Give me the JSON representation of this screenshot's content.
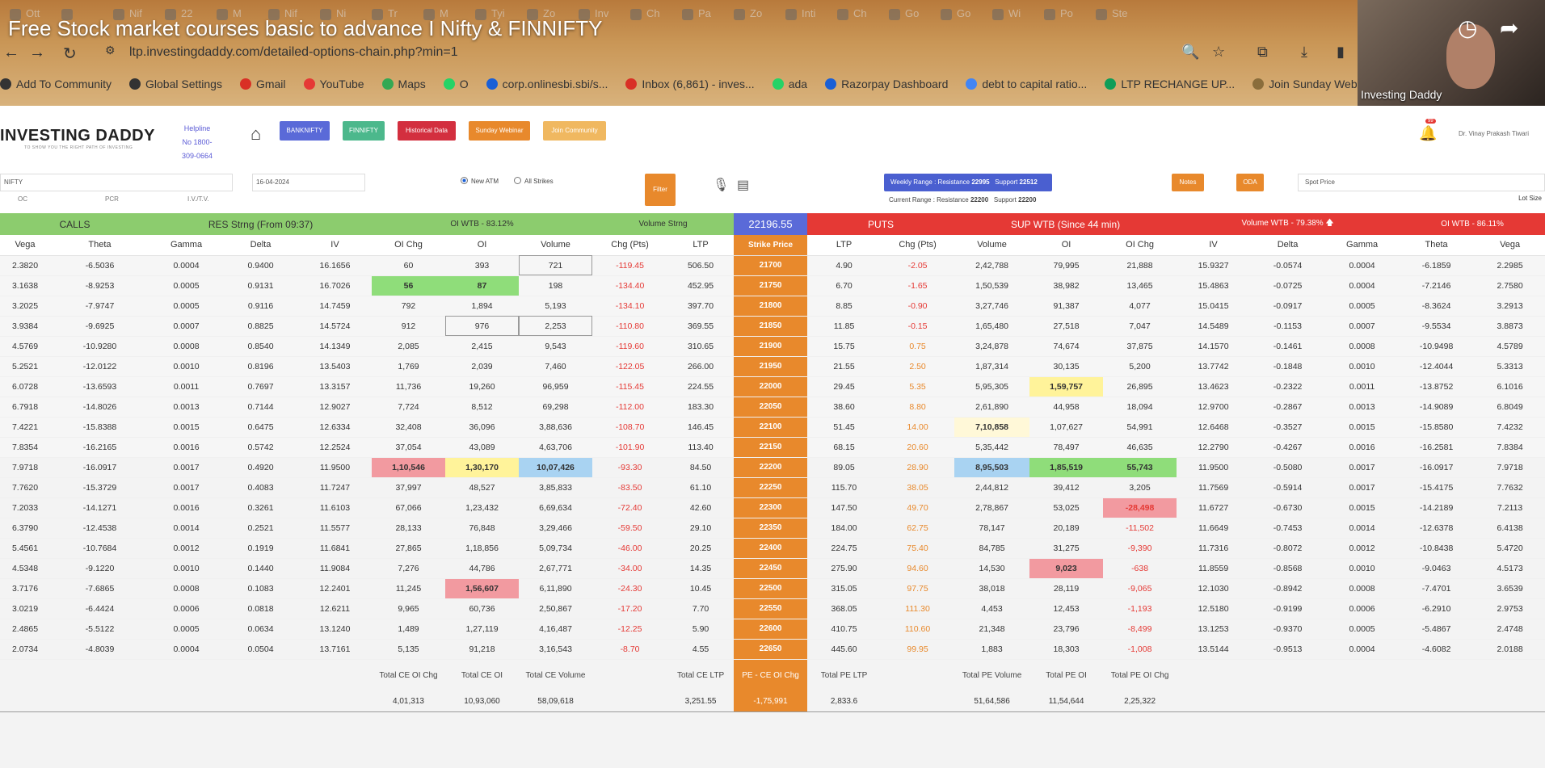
{
  "video": {
    "title": "Free Stock market courses basic to advance I Nifty & FINNIFTY",
    "presenter_label": "Investing Daddy"
  },
  "browser": {
    "tabs": [
      "Ott",
      "",
      "Nif",
      "22",
      "M",
      "Nif",
      "Ni",
      "Tr",
      "M",
      "Tyi",
      "Zo",
      "Inv",
      "Ch",
      "Pa",
      "Zo",
      "Inti",
      "Ch",
      "Go",
      "Go",
      "Wi",
      "Po",
      "Ste"
    ],
    "url": "ltp.investingdaddy.com/detailed-options-chain.php?min=1",
    "bookmarks": [
      {
        "label": "Add To Community",
        "color": "#333"
      },
      {
        "label": "Global Settings",
        "color": "#333"
      },
      {
        "label": "Gmail",
        "color": "#d93025"
      },
      {
        "label": "YouTube",
        "color": "#e53935"
      },
      {
        "label": "Maps",
        "color": "#34a853"
      },
      {
        "label": "O",
        "color": "#25d366"
      },
      {
        "label": "corp.onlinesbi.sbi/s...",
        "color": "#1a5fd6"
      },
      {
        "label": "Inbox (6,861) - inves...",
        "color": "#d93025"
      },
      {
        "label": "ada",
        "color": "#25d366"
      },
      {
        "label": "Razorpay Dashboard",
        "color": "#1a5fd6"
      },
      {
        "label": "debt to capital ratio...",
        "color": "#4285f4"
      },
      {
        "label": "LTP RECHANGE UP...",
        "color": "#0f9d58"
      },
      {
        "label": "Join Sunday Webina...",
        "color": "#8a6d3b"
      }
    ]
  },
  "header": {
    "logo": "INVESTING DADDY",
    "logo_tagline": "TO SHOW YOU THE RIGHT PATH OF INVESTING",
    "helpline": "Helpline No 1800-309-0664",
    "nav_buttons": [
      {
        "label": "BANKNIFTY",
        "color": "#5a6ad8"
      },
      {
        "label": "FINNIFTY",
        "color": "#4cb88c"
      },
      {
        "label": "Historical Data",
        "color": "#d32f3f"
      },
      {
        "label": "Sunday Webinar",
        "color": "#e8892c"
      },
      {
        "label": "Join Community",
        "color": "#f0b860"
      }
    ],
    "notification_count": "99",
    "user_name": "Dr. Vinay Prakash Tiwari"
  },
  "filters": {
    "symbol": "NIFTY",
    "date": "16-04-2024",
    "sub_labels": [
      "OC",
      "PCR",
      "I.V./T.V."
    ],
    "radio_new_atm": "New ATM",
    "radio_all_strikes": "All Strikes",
    "filter_button": "Filter",
    "weekly_range_label": "Weekly Range : Resistance",
    "weekly_resistance": "22995",
    "weekly_support_label": "Support",
    "weekly_support": "22512",
    "current_range_label": "Current Range : Resistance",
    "current_resistance": "22200",
    "current_support_label": "Support",
    "current_support": "22200",
    "notes_button": "Notes",
    "oda_button": "ODA",
    "spot_price_placeholder": "Spot Price",
    "lot_size_label": "Lot Size"
  },
  "sections": {
    "calls": "CALLS",
    "res_strng": "RES Strng (From 09:37)",
    "oi_wtb_calls": "OI WTB - 83.12%",
    "volume_strng": "Volume Strng",
    "spot": "22196.55",
    "puts": "PUTS",
    "sup_wtb": "SUP WTB (Since 44 min)",
    "volume_wtb_puts": "Volume WTB - 79.38%",
    "volume_wtb_arrow": "arrow-up-icon",
    "oi_wtb_puts": "OI WTB - 86.11%"
  },
  "columns": [
    "Vega",
    "Theta",
    "Gamma",
    "Delta",
    "IV",
    "OI Chg",
    "OI",
    "Volume",
    "Chg (Pts)",
    "LTP",
    "Strike Price",
    "LTP",
    "Chg (Pts)",
    "Volume",
    "OI",
    "OI Chg",
    "IV",
    "Delta",
    "Gamma",
    "Theta",
    "Vega"
  ],
  "rows": [
    {
      "c": [
        "2.3820",
        "-6.5036",
        "0.0004",
        "0.9400",
        "16.1656",
        "60",
        "393",
        "721",
        "-119.45",
        "506.50",
        "21700",
        "4.90",
        "-2.05",
        "2,42,788",
        "79,995",
        "21,888",
        "15.9327",
        "-0.0574",
        "0.0004",
        "-6.1859",
        "2.2985"
      ]
    },
    {
      "c": [
        "3.1638",
        "-8.9253",
        "0.0005",
        "0.9131",
        "16.7026",
        "56",
        "87",
        "198",
        "-134.40",
        "452.95",
        "21750",
        "6.70",
        "-1.65",
        "1,50,539",
        "38,982",
        "13,465",
        "15.4863",
        "-0.0725",
        "0.0004",
        "-7.2146",
        "2.7580"
      ]
    },
    {
      "c": [
        "3.2025",
        "-7.9747",
        "0.0005",
        "0.9116",
        "14.7459",
        "792",
        "1,894",
        "5,193",
        "-134.10",
        "397.70",
        "21800",
        "8.85",
        "-0.90",
        "3,27,746",
        "91,387",
        "4,077",
        "15.0415",
        "-0.0917",
        "0.0005",
        "-8.3624",
        "3.2913"
      ]
    },
    {
      "c": [
        "3.9384",
        "-9.6925",
        "0.0007",
        "0.8825",
        "14.5724",
        "912",
        "976",
        "2,253",
        "-110.80",
        "369.55",
        "21850",
        "11.85",
        "-0.15",
        "1,65,480",
        "27,518",
        "7,047",
        "14.5489",
        "-0.1153",
        "0.0007",
        "-9.5534",
        "3.8873"
      ]
    },
    {
      "c": [
        "4.5769",
        "-10.9280",
        "0.0008",
        "0.8540",
        "14.1349",
        "2,085",
        "2,415",
        "9,543",
        "-119.60",
        "310.65",
        "21900",
        "15.75",
        "0.75",
        "3,24,878",
        "74,674",
        "37,875",
        "14.1570",
        "-0.1461",
        "0.0008",
        "-10.9498",
        "4.5789"
      ]
    },
    {
      "c": [
        "5.2521",
        "-12.0122",
        "0.0010",
        "0.8196",
        "13.5403",
        "1,769",
        "2,039",
        "7,460",
        "-122.05",
        "266.00",
        "21950",
        "21.55",
        "2.50",
        "1,87,314",
        "30,135",
        "5,200",
        "13.7742",
        "-0.1848",
        "0.0010",
        "-12.4044",
        "5.3313"
      ]
    },
    {
      "c": [
        "6.0728",
        "-13.6593",
        "0.0011",
        "0.7697",
        "13.3157",
        "11,736",
        "19,260",
        "96,959",
        "-115.45",
        "224.55",
        "22000",
        "29.45",
        "5.35",
        "5,95,305",
        "1,59,757",
        "26,895",
        "13.4623",
        "-0.2322",
        "0.0011",
        "-13.8752",
        "6.1016"
      ]
    },
    {
      "c": [
        "6.7918",
        "-14.8026",
        "0.0013",
        "0.7144",
        "12.9027",
        "7,724",
        "8,512",
        "69,298",
        "-112.00",
        "183.30",
        "22050",
        "38.60",
        "8.80",
        "2,61,890",
        "44,958",
        "18,094",
        "12.9700",
        "-0.2867",
        "0.0013",
        "-14.9089",
        "6.8049"
      ]
    },
    {
      "c": [
        "7.4221",
        "-15.8388",
        "0.0015",
        "0.6475",
        "12.6334",
        "32,408",
        "36,096",
        "3,88,636",
        "-108.70",
        "146.45",
        "22100",
        "51.45",
        "14.00",
        "7,10,858",
        "1,07,627",
        "54,991",
        "12.6468",
        "-0.3527",
        "0.0015",
        "-15.8580",
        "7.4232"
      ]
    },
    {
      "c": [
        "7.8354",
        "-16.2165",
        "0.0016",
        "0.5742",
        "12.2524",
        "37,054",
        "43,089",
        "4,63,706",
        "-101.90",
        "113.40",
        "22150",
        "68.15",
        "20.60",
        "5,35,442",
        "78,497",
        "46,635",
        "12.2790",
        "-0.4267",
        "0.0016",
        "-16.2581",
        "7.8384"
      ]
    },
    {
      "c": [
        "7.9718",
        "-16.0917",
        "0.0017",
        "0.4920",
        "11.9500",
        "1,10,546",
        "1,30,170",
        "10,07,426",
        "-93.30",
        "84.50",
        "22200",
        "89.05",
        "28.90",
        "8,95,503",
        "1,85,519",
        "55,743",
        "11.9500",
        "-0.5080",
        "0.0017",
        "-16.0917",
        "7.9718"
      ]
    },
    {
      "c": [
        "7.7620",
        "-15.3729",
        "0.0017",
        "0.4083",
        "11.7247",
        "37,997",
        "48,527",
        "3,85,833",
        "-83.50",
        "61.10",
        "22250",
        "115.70",
        "38.05",
        "2,44,812",
        "39,412",
        "3,205",
        "11.7569",
        "-0.5914",
        "0.0017",
        "-15.4175",
        "7.7632"
      ]
    },
    {
      "c": [
        "7.2033",
        "-14.1271",
        "0.0016",
        "0.3261",
        "11.6103",
        "67,066",
        "1,23,432",
        "6,69,634",
        "-72.40",
        "42.60",
        "22300",
        "147.50",
        "49.70",
        "2,78,867",
        "53,025",
        "-28,498",
        "11.6727",
        "-0.6730",
        "0.0015",
        "-14.2189",
        "7.2113"
      ]
    },
    {
      "c": [
        "6.3790",
        "-12.4538",
        "0.0014",
        "0.2521",
        "11.5577",
        "28,133",
        "76,848",
        "3,29,466",
        "-59.50",
        "29.10",
        "22350",
        "184.00",
        "62.75",
        "78,147",
        "20,189",
        "-11,502",
        "11.6649",
        "-0.7453",
        "0.0014",
        "-12.6378",
        "6.4138"
      ]
    },
    {
      "c": [
        "5.4561",
        "-10.7684",
        "0.0012",
        "0.1919",
        "11.6841",
        "27,865",
        "1,18,856",
        "5,09,734",
        "-46.00",
        "20.25",
        "22400",
        "224.75",
        "75.40",
        "84,785",
        "31,275",
        "-9,390",
        "11.7316",
        "-0.8072",
        "0.0012",
        "-10.8438",
        "5.4720"
      ]
    },
    {
      "c": [
        "4.5348",
        "-9.1220",
        "0.0010",
        "0.1440",
        "11.9084",
        "7,276",
        "44,786",
        "2,67,771",
        "-34.00",
        "14.35",
        "22450",
        "275.90",
        "94.60",
        "14,530",
        "9,023",
        "-638",
        "11.8559",
        "-0.8568",
        "0.0010",
        "-9.0463",
        "4.5173"
      ]
    },
    {
      "c": [
        "3.7176",
        "-7.6865",
        "0.0008",
        "0.1083",
        "12.2401",
        "11,245",
        "1,56,607",
        "6,11,890",
        "-24.30",
        "10.45",
        "22500",
        "315.05",
        "97.75",
        "38,018",
        "28,119",
        "-9,065",
        "12.1030",
        "-0.8942",
        "0.0008",
        "-7.4701",
        "3.6539"
      ]
    },
    {
      "c": [
        "3.0219",
        "-6.4424",
        "0.0006",
        "0.0818",
        "12.6211",
        "9,965",
        "60,736",
        "2,50,867",
        "-17.20",
        "7.70",
        "22550",
        "368.05",
        "111.30",
        "4,453",
        "12,453",
        "-1,193",
        "12.5180",
        "-0.9199",
        "0.0006",
        "-6.2910",
        "2.9753"
      ]
    },
    {
      "c": [
        "2.4865",
        "-5.5122",
        "0.0005",
        "0.0634",
        "13.1240",
        "1,489",
        "1,27,119",
        "4,16,487",
        "-12.25",
        "5.90",
        "22600",
        "410.75",
        "110.60",
        "21,348",
        "23,796",
        "-8,499",
        "13.1253",
        "-0.9370",
        "0.0005",
        "-5.4867",
        "2.4748"
      ]
    },
    {
      "c": [
        "2.0734",
        "-4.8039",
        "0.0004",
        "0.0504",
        "13.7161",
        "5,135",
        "91,218",
        "3,16,543",
        "-8.70",
        "4.55",
        "22650",
        "445.60",
        "99.95",
        "1,883",
        "18,303",
        "-1,008",
        "13.5144",
        "-0.9513",
        "0.0004",
        "-4.6082",
        "2.0188"
      ]
    }
  ],
  "totals": {
    "labels": {
      "ce_oichg": "Total CE OI Chg",
      "ce_oi": "Total CE OI",
      "ce_volume": "Total CE Volume",
      "ce_ltp": "Total CE LTP",
      "pe_ce": "PE - CE OI Chg",
      "pe_ltp": "Total PE LTP",
      "pe_volume": "Total PE Volume",
      "pe_oi": "Total PE OI",
      "pe_oichg": "Total PE OI Chg"
    },
    "values": {
      "ce_oichg": "4,01,313",
      "ce_oi": "10,93,060",
      "ce_volume": "58,09,618",
      "ce_ltp": "3,251.55",
      "pe_ce": "-1,75,991",
      "pe_ltp": "2,833.6",
      "pe_volume": "51,64,586",
      "pe_oi": "11,54,644",
      "pe_oichg": "2,25,322"
    }
  },
  "colors": {
    "calls_green": "#8ccc6e",
    "puts_red": "#e53935",
    "strike_orange": "#e8892c",
    "spot_blue": "#5a6ad8"
  }
}
